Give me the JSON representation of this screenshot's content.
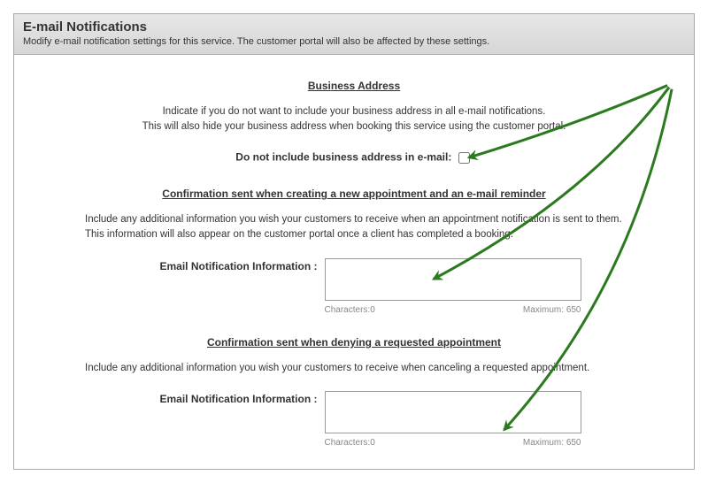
{
  "header": {
    "title": "E-mail Notifications",
    "subtitle": "Modify e-mail notification settings for this service. The customer portal will also be affected by these settings."
  },
  "sections": {
    "business_address": {
      "title": "Business Address",
      "blurb_line1": "Indicate if you do not want to include your business address in all e-mail notifications.",
      "blurb_line2": "This will also hide your business address when booking this service using the customer portal.",
      "checkbox_label": "Do not include business address in e-mail:"
    },
    "confirm_create": {
      "title": "Confirmation sent when creating a new appointment and an e-mail reminder",
      "blurb": "Include any additional information you wish your customers to receive when an appointment notification is sent to them. This information will also appear on the customer portal once a client has completed a booking.",
      "field_label": "Email Notification Information :",
      "value": "",
      "char_label": "Characters:",
      "char_count": "0",
      "max_label": "Maximum:",
      "max_count": "650"
    },
    "confirm_deny": {
      "title": "Confirmation sent when denying a requested appointment",
      "blurb": "Include any additional information you wish your customers to receive when canceling a requested appointment.",
      "field_label": "Email Notification Information :",
      "value": "",
      "char_label": "Characters:",
      "char_count": "0",
      "max_label": "Maximum:",
      "max_count": "650"
    }
  },
  "colors": {
    "arrow": "#2c7a1f"
  }
}
